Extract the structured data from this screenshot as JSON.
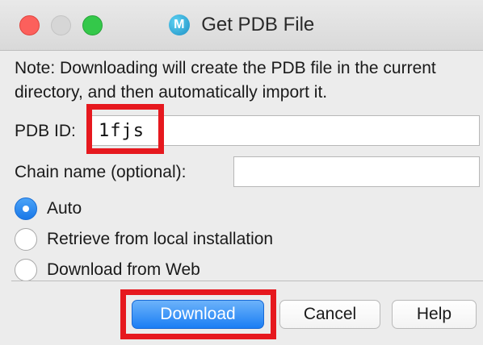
{
  "window": {
    "title": "Get PDB File",
    "app_icon_letter": "M"
  },
  "note": "Note:  Downloading will create the PDB file in the current directory, and then automatically import it.",
  "fields": {
    "pdb_id_label": "PDB ID:",
    "pdb_id_value": "1fjs",
    "chain_label": "Chain name (optional):",
    "chain_value": ""
  },
  "source_options": [
    {
      "label": "Auto",
      "selected": true
    },
    {
      "label": "Retrieve from local installation",
      "selected": false
    },
    {
      "label": "Download from Web",
      "selected": false
    }
  ],
  "buttons": {
    "download": "Download",
    "cancel": "Cancel",
    "help": "Help"
  },
  "colors": {
    "highlight": "#e6181e",
    "accent": "#1b7ef4",
    "close": "#fc605c",
    "zoom": "#34c84a"
  }
}
